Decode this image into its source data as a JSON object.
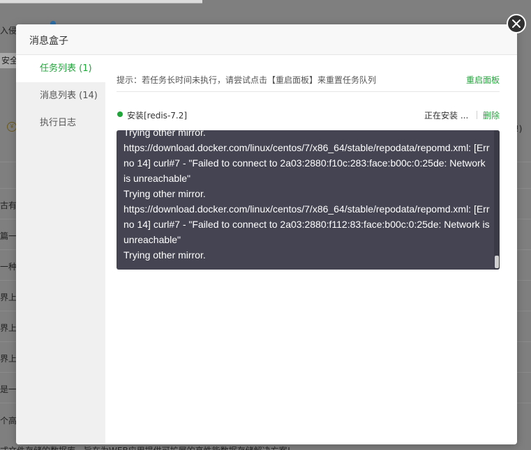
{
  "modal": {
    "title": "消息盒子",
    "close_icon": "close-icon"
  },
  "sidebar": {
    "items": [
      {
        "label": "任务列表 (1)",
        "active": true
      },
      {
        "label": "消息列表 (14)",
        "active": false
      },
      {
        "label": "执行日志",
        "active": false
      }
    ]
  },
  "tip": {
    "text": "提示：若任务长时间未执行，请尝试点击【重启面板】来重置任务队列",
    "restart_label": "重启面板"
  },
  "task": {
    "name": "安装[redis-7.2]",
    "status": "正在安装 ...",
    "delete_label": "删除",
    "log": "Trying other mirror.\nhttps://download.docker.com/linux/centos/7/x86_64/stable/repodata/repomd.xml: [Errno 14] curl#7 - \"Failed to connect to 2a03:2880:f10c:283:face:b00c:0:25de: Network is unreachable\"\nTrying other mirror.\nhttps://download.docker.com/linux/centos/7/x86_64/stable/repodata/repomd.xml: [Errno 14] curl#7 - \"Failed to connect to 2a03:2880:f112:83:face:b00c:0:25de: Network is unreachable\"\nTrying other mirror."
  },
  "background": {
    "fragments": [
      "入侵检",
      "安全",
      "古有的",
      "篇一,",
      "一种",
      "界上最",
      "界上最",
      "界上最",
      "是一",
      "个高",
      "式文件存储的数据库，旨在为WEB应用提供可扩展的高性能数据存储解决方案!",
      "!)"
    ]
  },
  "colors": {
    "accent": "#20a53a",
    "log_bg": "#444452",
    "overlay": "#7f7f7f"
  }
}
